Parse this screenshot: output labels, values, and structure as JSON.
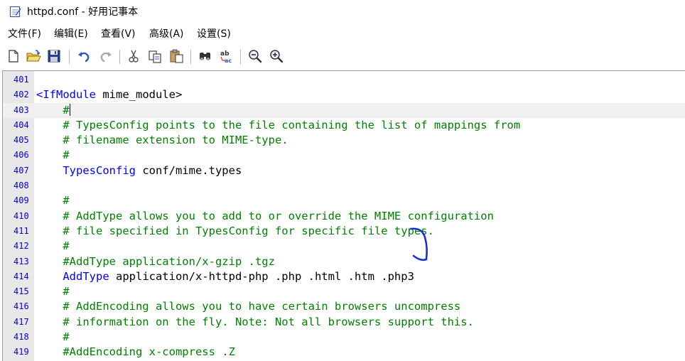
{
  "window": {
    "title": "httpd.conf - 好用记事本"
  },
  "menu": [
    {
      "label": "文件(F)"
    },
    {
      "label": "编辑(E)"
    },
    {
      "label": "查看(V)"
    },
    {
      "label": "高级(A)"
    },
    {
      "label": "设置(S)"
    }
  ],
  "toolbar": [
    {
      "icon": "new-file-icon"
    },
    {
      "icon": "open-folder-icon"
    },
    {
      "icon": "save-icon"
    },
    {
      "icon": "undo-icon"
    },
    {
      "icon": "redo-icon"
    },
    {
      "icon": "cut-icon"
    },
    {
      "icon": "copy-icon"
    },
    {
      "icon": "paste-icon"
    },
    {
      "icon": "find-icon"
    },
    {
      "icon": "replace-icon"
    },
    {
      "icon": "zoom-out-icon"
    },
    {
      "icon": "zoom-in-icon"
    }
  ],
  "colors": {
    "line_number": "#0000c8",
    "comment": "#008000",
    "directive": "#0000ff",
    "tag": "#0000ff",
    "gutter_bg": "#e8e8e8",
    "current_line_bg": "#f0f0f0",
    "annotation_ink": "#1a2fd6"
  },
  "editor": {
    "current_line": 403,
    "lines": [
      {
        "number": "401",
        "tokens": []
      },
      {
        "number": "402",
        "tokens": [
          {
            "t": "tag",
            "v": "<IfModule"
          },
          {
            "t": "plain",
            "v": " mime_module>"
          }
        ]
      },
      {
        "number": "403",
        "tokens": [
          {
            "t": "plain",
            "v": "    "
          },
          {
            "t": "comment",
            "v": "#"
          }
        ],
        "caret": true
      },
      {
        "number": "404",
        "tokens": [
          {
            "t": "plain",
            "v": "    "
          },
          {
            "t": "comment",
            "v": "# TypesConfig points to the file containing the list of mappings from"
          }
        ]
      },
      {
        "number": "405",
        "tokens": [
          {
            "t": "plain",
            "v": "    "
          },
          {
            "t": "comment",
            "v": "# filename extension to MIME-type."
          }
        ]
      },
      {
        "number": "406",
        "tokens": [
          {
            "t": "plain",
            "v": "    "
          },
          {
            "t": "comment",
            "v": "#"
          }
        ]
      },
      {
        "number": "407",
        "tokens": [
          {
            "t": "plain",
            "v": "    "
          },
          {
            "t": "directive",
            "v": "TypesConfig"
          },
          {
            "t": "plain",
            "v": " conf/mime.types"
          }
        ]
      },
      {
        "number": "408",
        "tokens": []
      },
      {
        "number": "409",
        "tokens": [
          {
            "t": "plain",
            "v": "    "
          },
          {
            "t": "comment",
            "v": "#"
          }
        ]
      },
      {
        "number": "410",
        "tokens": [
          {
            "t": "plain",
            "v": "    "
          },
          {
            "t": "comment",
            "v": "# AddType allows you to add to or override the MIME configuration"
          }
        ]
      },
      {
        "number": "411",
        "tokens": [
          {
            "t": "plain",
            "v": "    "
          },
          {
            "t": "comment",
            "v": "# file specified in TypesConfig for specific file types."
          }
        ]
      },
      {
        "number": "412",
        "tokens": [
          {
            "t": "plain",
            "v": "    "
          },
          {
            "t": "comment",
            "v": "#"
          }
        ]
      },
      {
        "number": "413",
        "tokens": [
          {
            "t": "plain",
            "v": "    "
          },
          {
            "t": "comment",
            "v": "#AddType application/x-gzip .tgz"
          }
        ]
      },
      {
        "number": "414",
        "tokens": [
          {
            "t": "plain",
            "v": "    "
          },
          {
            "t": "directive",
            "v": "AddType"
          },
          {
            "t": "plain",
            "v": " application/x-httpd-php .php .html .htm .php3"
          }
        ]
      },
      {
        "number": "415",
        "tokens": [
          {
            "t": "plain",
            "v": "    "
          },
          {
            "t": "comment",
            "v": "#"
          }
        ]
      },
      {
        "number": "416",
        "tokens": [
          {
            "t": "plain",
            "v": "    "
          },
          {
            "t": "comment",
            "v": "# AddEncoding allows you to have certain browsers uncompress"
          }
        ]
      },
      {
        "number": "417",
        "tokens": [
          {
            "t": "plain",
            "v": "    "
          },
          {
            "t": "comment",
            "v": "# information on the fly. Note: Not all browsers support this."
          }
        ]
      },
      {
        "number": "418",
        "tokens": [
          {
            "t": "plain",
            "v": "    "
          },
          {
            "t": "comment",
            "v": "#"
          }
        ]
      },
      {
        "number": "419",
        "tokens": [
          {
            "t": "plain",
            "v": "    "
          },
          {
            "t": "comment",
            "v": "#AddEncoding x-compress .Z"
          }
        ]
      }
    ]
  }
}
